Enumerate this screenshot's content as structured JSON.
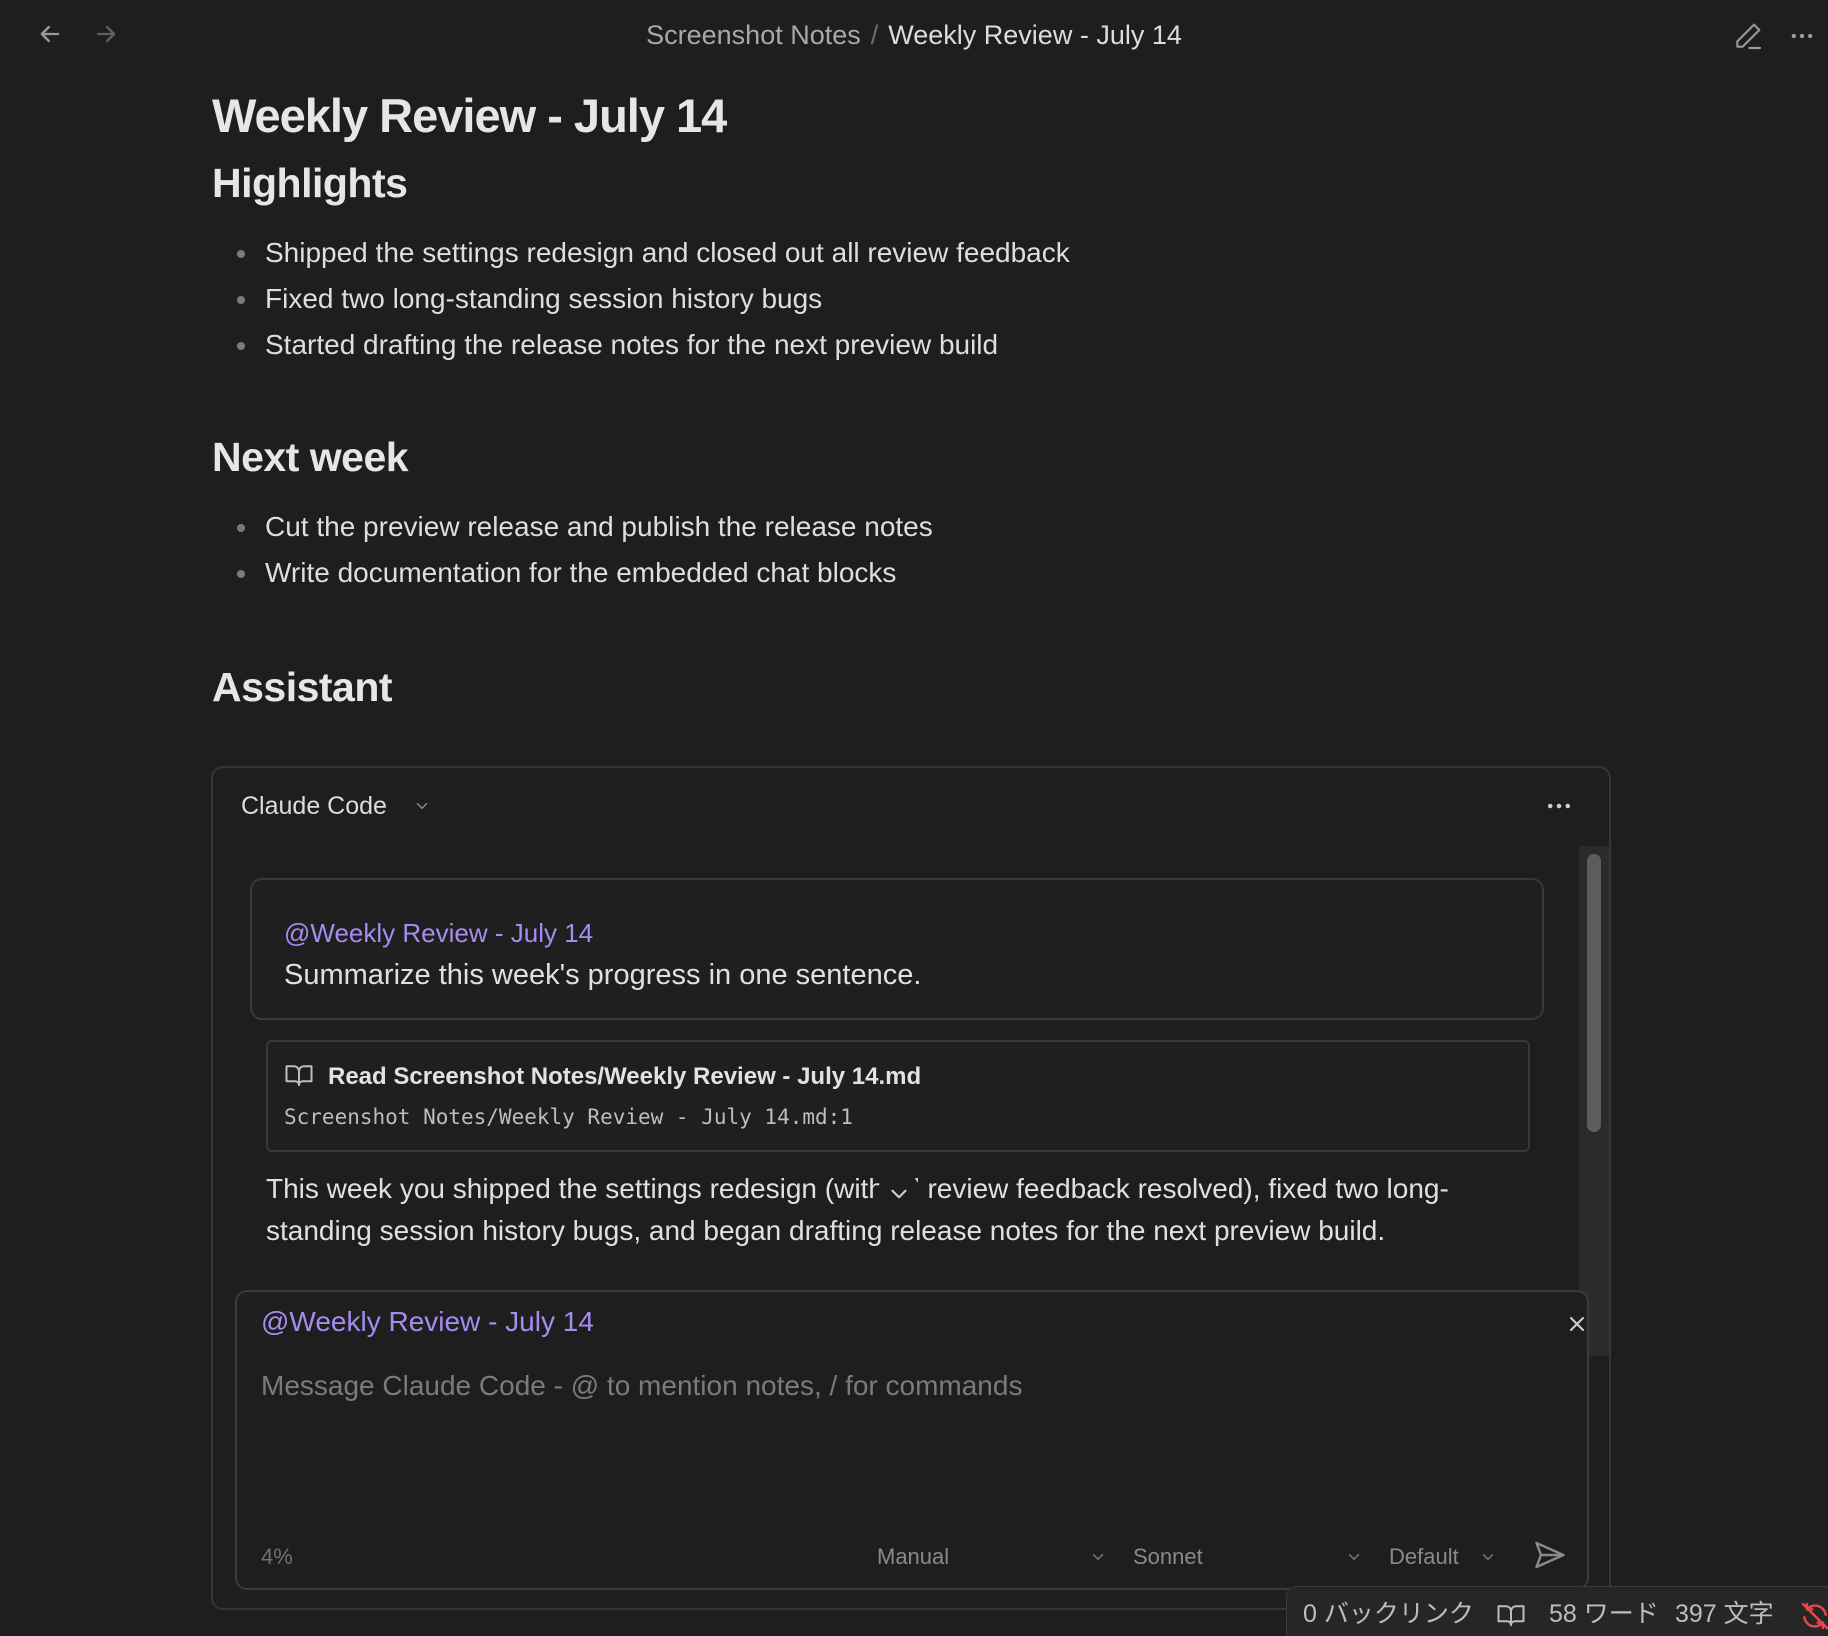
{
  "topbar": {
    "folder": "Screenshot Notes",
    "separator": "/",
    "title": "Weekly Review - July 14"
  },
  "note": {
    "title": "Weekly Review - July 14",
    "sections": [
      {
        "heading": "Highlights",
        "items": [
          "Shipped the settings redesign and closed out all review feedback",
          "Fixed two long-standing session history bugs",
          "Started drafting the release notes for the next preview build"
        ]
      },
      {
        "heading": "Next week",
        "items": [
          "Cut the preview release and publish the release notes",
          "Write documentation for the embedded chat blocks"
        ]
      }
    ],
    "assistant_heading": "Assistant"
  },
  "assistant": {
    "agent": "Claude Code",
    "user_message": {
      "mention": "@Weekly Review - July 14",
      "text": "Summarize this week's progress in one sentence."
    },
    "tool_call": {
      "title": "Read Screenshot Notes/Weekly Review - July 14.md",
      "path": "Screenshot Notes/Weekly Review - July 14.md:1"
    },
    "reply": "This week you shipped the settings redesign (with all review feedback resolved), fixed two long-standing session history bugs, and began drafting release notes for the next preview build.",
    "composer": {
      "mention": "@Weekly Review - July 14",
      "placeholder": "Message Claude Code - @ to mention notes, / for commands",
      "value": "",
      "context_usage": "4%",
      "mode": "Manual",
      "model": "Sonnet",
      "effort": "Default"
    }
  },
  "statusbar": {
    "backlinks": "0 バックリンク",
    "words": "58 ワード",
    "chars": "397 文字"
  },
  "icons": {
    "back": "arrow-left-icon",
    "forward": "arrow-right-icon",
    "edit": "pencil-icon",
    "more": "ellipsis-icon",
    "tool": "book-open-icon",
    "close": "close-icon",
    "send": "send-icon",
    "sync": "sync-off-icon"
  },
  "colors": {
    "background": "#1e1e1e",
    "accent_mention": "#a58cf0",
    "sync_error": "#e5484d"
  }
}
